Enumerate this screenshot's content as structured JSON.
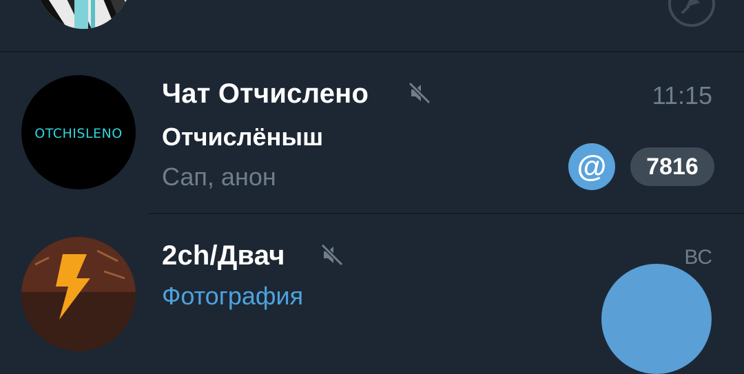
{
  "chats": [
    {
      "title": "Чат Отчислено",
      "muted": true,
      "time": "11:15",
      "sender": "Отчислёныш",
      "preview": "Сап, анон",
      "avatar_text": "OTCHISLENO",
      "mention_badge": "@",
      "unread_count": "7816"
    },
    {
      "title": "2ch/Двач",
      "muted": true,
      "time": "ВС",
      "preview": "Фотография"
    }
  ],
  "colors": {
    "background": "#1d2733",
    "accent": "#5aa3dc",
    "muted_text": "#6f7e8c",
    "media_link": "#4da3e0",
    "badge_gray": "#3e4a56"
  },
  "icons": {
    "pinned": "pin-icon",
    "muted": "mute-icon",
    "mention": "at-icon",
    "fab": "compose-icon"
  }
}
